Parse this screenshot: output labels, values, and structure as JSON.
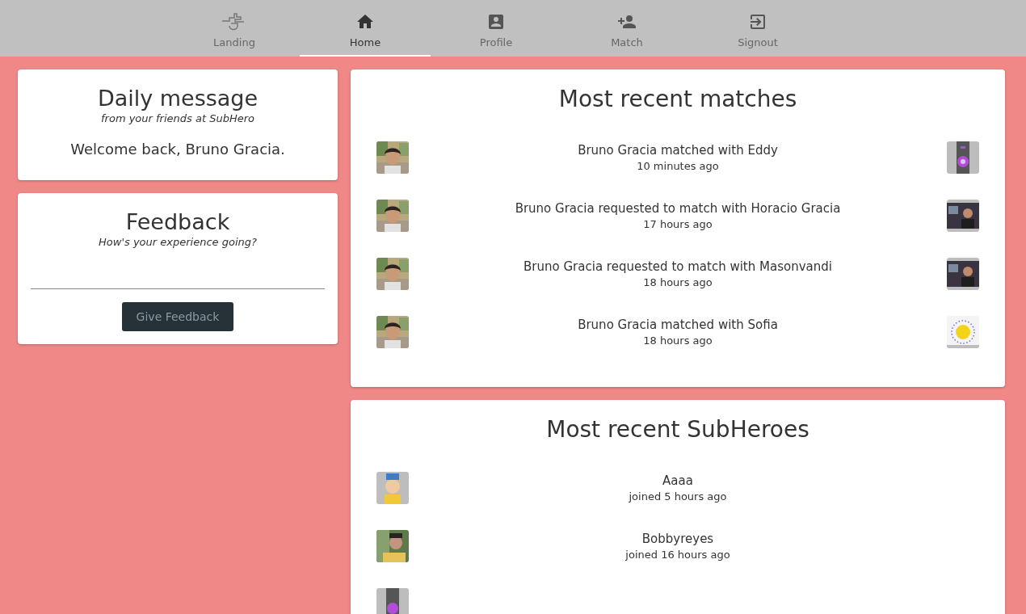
{
  "nav": {
    "tabs": [
      {
        "label": "Landing",
        "kind": "logo",
        "selected": false
      },
      {
        "label": "Home",
        "kind": "home",
        "selected": true
      },
      {
        "label": "Profile",
        "kind": "profile",
        "selected": false
      },
      {
        "label": "Match",
        "kind": "match",
        "selected": false
      },
      {
        "label": "Signout",
        "kind": "signout",
        "selected": false
      }
    ]
  },
  "daily_message": {
    "title": "Daily message",
    "subtitle": "from your friends at SubHero",
    "message": "Welcome back, Bruno Gracia."
  },
  "feedback": {
    "title": "Feedback",
    "subtitle": "How's your experience going?",
    "button": {
      "label": "Give Feedback",
      "disabled": true
    }
  },
  "recent_matches": {
    "title": "Most recent matches",
    "items": [
      {
        "text": "Bruno Gracia matched with Eddy",
        "time": "10 minutes ago",
        "kind": "device"
      },
      {
        "text": "Bruno Gracia requested to match with Horacio Gracia",
        "time": "17 hours ago",
        "kind": "person"
      },
      {
        "text": "Bruno Gracia requested to match with Masonvandi",
        "time": "18 hours ago",
        "kind": "person"
      },
      {
        "text": "Bruno Gracia matched with Sofia",
        "time": "18 hours ago",
        "kind": "sun"
      }
    ]
  },
  "recent_subheroes": {
    "title": "Most recent SubHeroes",
    "items": [
      {
        "name": "Aaaa",
        "joined": "joined 5 hours ago",
        "kind": "cartoon"
      },
      {
        "name": "Bobbyreyes",
        "joined": "joined 16 hours ago",
        "kind": "person"
      },
      {
        "kind": "device"
      }
    ]
  }
}
